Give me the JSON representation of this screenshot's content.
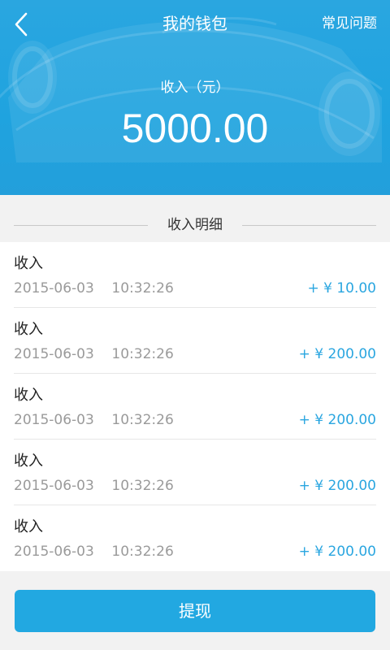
{
  "header": {
    "title": "我的钱包",
    "faq_label": "常见问题",
    "income_label": "收入（元）",
    "income_amount": "5000.00",
    "back_icon": "chevron-left-icon",
    "background": "#2aa6e0"
  },
  "section": {
    "title": "收入明细"
  },
  "records": [
    {
      "type": "收入",
      "datetime": "2015-06-03    10:32:26",
      "amount": "+ ¥ 10.00"
    },
    {
      "type": "收入",
      "datetime": "2015-06-03    10:32:26",
      "amount": "+ ¥ 200.00"
    },
    {
      "type": "收入",
      "datetime": "2015-06-03    10:32:26",
      "amount": "+ ¥ 200.00"
    },
    {
      "type": "收入",
      "datetime": "2015-06-03    10:32:26",
      "amount": "+ ¥ 200.00"
    },
    {
      "type": "收入",
      "datetime": "2015-06-03    10:32:26",
      "amount": "+ ¥ 200.00"
    }
  ],
  "footer": {
    "withdraw_label": "提现",
    "accent": "#22a8e1"
  }
}
